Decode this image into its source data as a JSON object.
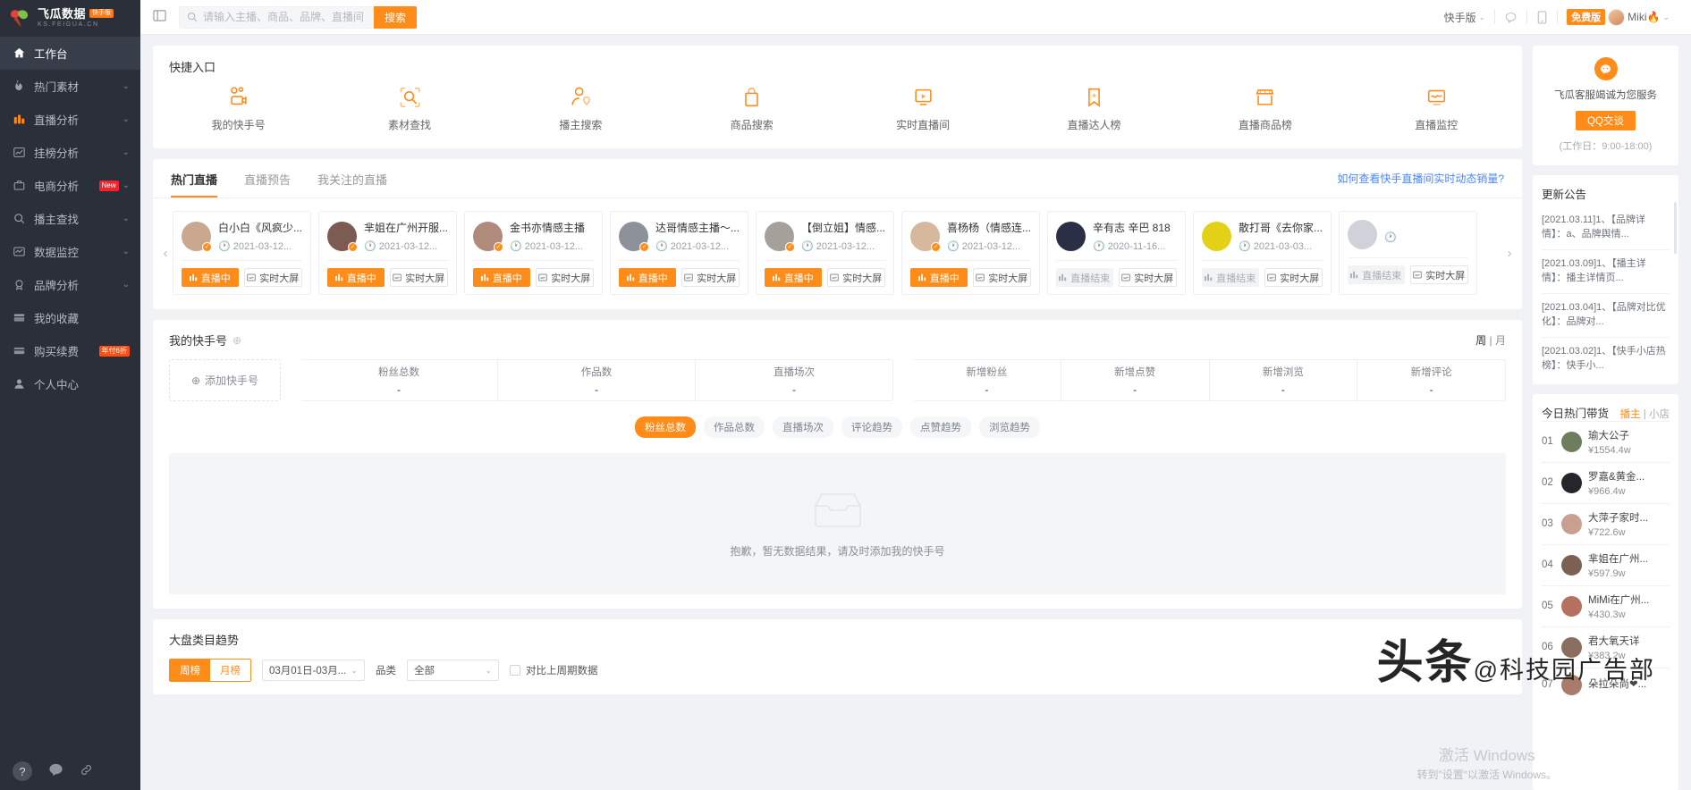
{
  "brand": {
    "name_cn": "飞瓜数据",
    "badge": "快手版",
    "name_en": "KS.FEIGUA.CN"
  },
  "sidebar": {
    "items": [
      {
        "label": "工作台",
        "icon": "home-icon",
        "active": true,
        "caret": false,
        "tag": ""
      },
      {
        "label": "热门素材",
        "icon": "fire-icon",
        "active": false,
        "caret": true,
        "tag": ""
      },
      {
        "label": "直播分析",
        "icon": "bar-chart-icon",
        "active": false,
        "caret": true,
        "tag": ""
      },
      {
        "label": "挂榜分析",
        "icon": "line-chart-icon",
        "active": false,
        "caret": true,
        "tag": ""
      },
      {
        "label": "电商分析",
        "icon": "briefcase-icon",
        "active": false,
        "caret": true,
        "tag": "New"
      },
      {
        "label": "播主查找",
        "icon": "search-icon",
        "active": false,
        "caret": true,
        "tag": ""
      },
      {
        "label": "数据监控",
        "icon": "monitor-icon",
        "active": false,
        "caret": true,
        "tag": ""
      },
      {
        "label": "品牌分析",
        "icon": "medal-icon",
        "active": false,
        "caret": true,
        "tag": ""
      },
      {
        "label": "我的收藏",
        "icon": "star-box-icon",
        "active": false,
        "caret": false,
        "tag": ""
      },
      {
        "label": "购买续费",
        "icon": "card-icon",
        "active": false,
        "caret": false,
        "tag": "年付6折"
      },
      {
        "label": "个人中心",
        "icon": "user-icon",
        "active": false,
        "caret": false,
        "tag": ""
      }
    ],
    "help_label": "?",
    "chat_icon": "chat-icon",
    "link_icon": "link-icon"
  },
  "header": {
    "collapse_icon": "collapse-menu-icon",
    "search_placeholder": "请输入主播、商品、品牌、直播间",
    "search_value": "",
    "search_button": "搜索",
    "version_switch": "快手版",
    "cloud_icon": "cloud-chat-icon",
    "mobile_icon": "mobile-icon",
    "plan_badge": "免费版",
    "username": "Miki🔥"
  },
  "quick_entry": {
    "title": "快捷入口",
    "items": [
      {
        "label": "我的快手号",
        "icon": "video-account-icon"
      },
      {
        "label": "素材查找",
        "icon": "scan-search-icon"
      },
      {
        "label": "播主搜索",
        "icon": "person-locate-icon"
      },
      {
        "label": "商品搜索",
        "icon": "shopping-bag-icon"
      },
      {
        "label": "实时直播间",
        "icon": "live-screen-icon"
      },
      {
        "label": "直播达人榜",
        "icon": "bookmark-star-icon"
      },
      {
        "label": "直播商品榜",
        "icon": "store-icon"
      },
      {
        "label": "直播监控",
        "icon": "wave-monitor-icon"
      }
    ]
  },
  "live_section": {
    "tabs": [
      {
        "label": "热门直播",
        "active": true
      },
      {
        "label": "直播预告",
        "active": false
      },
      {
        "label": "我关注的直播",
        "active": false
      }
    ],
    "help_link": "如何查看快手直播间实时动态销量?",
    "prev_icon": "chevron-left-icon",
    "next_icon": "chevron-right-icon",
    "badge_live": "直播中",
    "badge_ended": "直播结束",
    "btn_screen": "实时大屏",
    "cards": [
      {
        "name": "白小白《风疯少...",
        "time": "2021-03-12...",
        "status": "live",
        "avatar_color": "#c9a88f"
      },
      {
        "name": "芈姐在广州开服...",
        "time": "2021-03-12...",
        "status": "live",
        "avatar_color": "#7c5b52"
      },
      {
        "name": "金书亦情感主播",
        "time": "2021-03-12...",
        "status": "live",
        "avatar_color": "#b08a7a"
      },
      {
        "name": "达哥情感主播～...",
        "time": "2021-03-12...",
        "status": "live",
        "avatar_color": "#8d9199"
      },
      {
        "name": "【倒立姐】情感...",
        "time": "2021-03-12...",
        "status": "live",
        "avatar_color": "#a6a09a"
      },
      {
        "name": "喜杨杨（情感连...",
        "time": "2021-03-12...",
        "status": "live",
        "avatar_color": "#d6b89c"
      },
      {
        "name": "辛有志 辛巴 818",
        "time": "2020-11-16...",
        "status": "ended",
        "avatar_color": "#2b2f46"
      },
      {
        "name": "散打哥《去你家...",
        "time": "2021-03-03...",
        "status": "ended",
        "avatar_color": "#e3d117"
      },
      {
        "name": "",
        "time": "",
        "status": "ended",
        "avatar_color": "#cfd3d9"
      }
    ]
  },
  "my_account": {
    "title": "我的快手号",
    "plus_icon": "plus-circle-icon",
    "toggle_week": "周",
    "toggle_month": "月",
    "add_label": "添加快手号",
    "add_icon": "plus-circle-icon",
    "stats_left": [
      {
        "label": "粉丝总数",
        "value": "-"
      },
      {
        "label": "作品数",
        "value": "-"
      },
      {
        "label": "直播场次",
        "value": "-"
      }
    ],
    "stats_right": [
      {
        "label": "新增粉丝",
        "value": "-"
      },
      {
        "label": "新增点赞",
        "value": "-"
      },
      {
        "label": "新增浏览",
        "value": "-"
      },
      {
        "label": "新增评论",
        "value": "-"
      }
    ],
    "chips": [
      {
        "label": "粉丝总数",
        "active": true
      },
      {
        "label": "作品总数",
        "active": false
      },
      {
        "label": "直播场次",
        "active": false
      },
      {
        "label": "评论趋势",
        "active": false
      },
      {
        "label": "点赞趋势",
        "active": false
      },
      {
        "label": "浏览趋势",
        "active": false
      }
    ],
    "empty_text": "抱歉，暂无数据结果，请及时添加我的快手号",
    "empty_icon": "empty-inbox-icon"
  },
  "trend": {
    "title": "大盘类目趋势",
    "seg": [
      {
        "label": "周榜",
        "active": true
      },
      {
        "label": "月榜",
        "active": false
      }
    ],
    "date_value": "03月01日-03月...",
    "category_label": "品类",
    "category_value": "全部",
    "compare_label": "对比上周期数据",
    "compare_checked": false
  },
  "rail": {
    "service": {
      "icon": "qq-chat-icon",
      "text": "飞瓜客服竭诚为您服务",
      "button": "QQ交谈",
      "hours": "(工作日：9:00-18:00)"
    },
    "news": {
      "title": "更新公告",
      "items": [
        "[2021.03.11]1、【品牌详情】：a、品牌舆情...",
        "[2021.03.09]1、【播主详情】：播主详情页...",
        "[2021.03.04]1、【品牌对比优化】：品牌对...",
        "[2021.03.02]1、【快手小店热榜】：快手小..."
      ]
    },
    "hot": {
      "title": "今日热门带货",
      "tab_primary": "播主",
      "tab_divider": "|",
      "tab_secondary": "小店",
      "rows": [
        {
          "rank": "01",
          "name": "瑜大公子",
          "value": "¥1554.4w",
          "avatar_color": "#6f7d5e"
        },
        {
          "rank": "02",
          "name": "罗嘉&黄金...",
          "value": "¥966.4w",
          "avatar_color": "#24262b"
        },
        {
          "rank": "03",
          "name": "大萍子家时...",
          "value": "¥722.6w",
          "avatar_color": "#c9a08f"
        },
        {
          "rank": "04",
          "name": "芈姐在广州...",
          "value": "¥597.9w",
          "avatar_color": "#7d6054"
        },
        {
          "rank": "05",
          "name": "MiMi在广州...",
          "value": "¥430.3w",
          "avatar_color": "#b5705f"
        },
        {
          "rank": "06",
          "name": "君大氧天详",
          "value": "¥383.2w",
          "avatar_color": "#8b6f5e"
        },
        {
          "rank": "07",
          "name": "朵拉朵尚❤...",
          "value": "",
          "avatar_color": "#a87b6a"
        }
      ]
    }
  },
  "overlay": {
    "watermark_main": "头条",
    "watermark_sub": "@科技园广告部",
    "windows_line1": "激活 Windows",
    "windows_line2": "转到\"设置\"以激活 Windows。"
  }
}
